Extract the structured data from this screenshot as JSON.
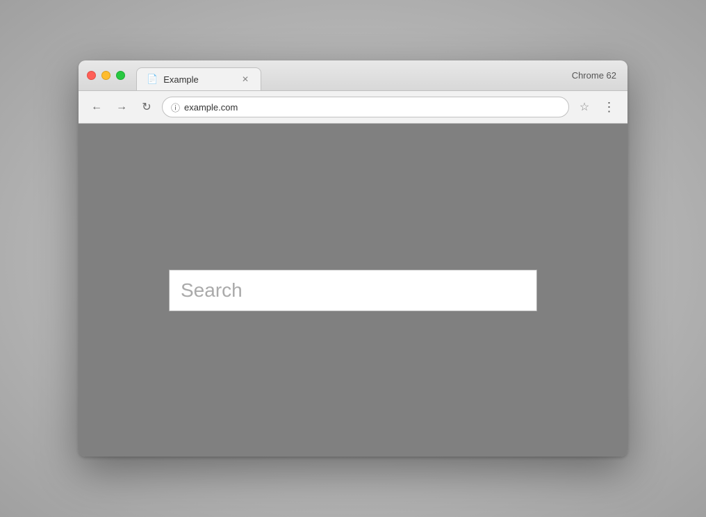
{
  "browser": {
    "chrome_label": "Chrome 62",
    "tab": {
      "title": "Example",
      "icon": "📄"
    },
    "address_bar": {
      "url": "example.com",
      "placeholder": "example.com"
    },
    "nav": {
      "back_label": "←",
      "forward_label": "→",
      "reload_label": "↻"
    },
    "star_label": "☆",
    "menu_label": "⋮"
  },
  "page": {
    "search_placeholder": "Search"
  }
}
